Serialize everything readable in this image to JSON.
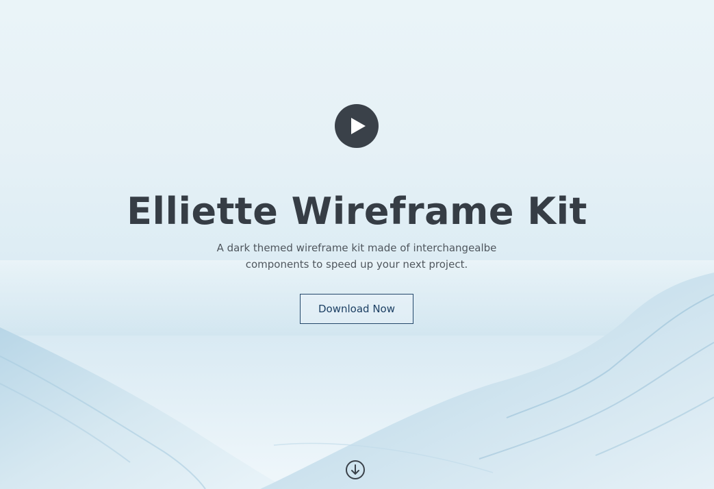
{
  "hero": {
    "title": "Elliette Wireframe Kit",
    "subtitle": "A dark themed wireframe kit made of interchangealbe components to speed up your next project.",
    "download_label": "Download Now",
    "play_icon": "play-icon",
    "scroll_icon": "arrow-down-circle-icon"
  },
  "colors": {
    "dark": "#363d45",
    "accent": "#1c3f63",
    "background": "#e6f1f6"
  }
}
